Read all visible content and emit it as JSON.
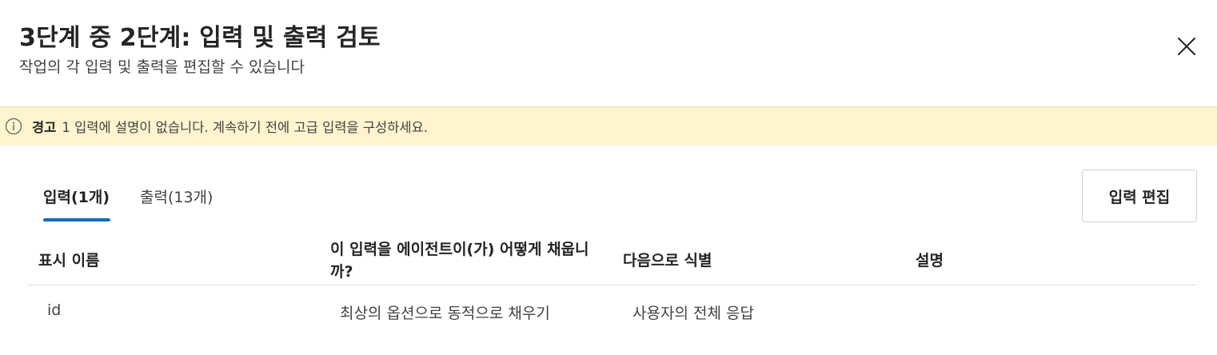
{
  "header": {
    "title": "3단계 중 2단계: 입력 및 출력 검토",
    "subtitle": "작업의 각 입력 및 출력을 편집할 수 있습니다",
    "close_icon": "close-icon"
  },
  "warning": {
    "icon": "info-icon",
    "label": "경고",
    "message": "1 입력에 설명이 없습니다. 계속하기 전에 고급 입력을 구성하세요.",
    "background": "#fff4ce"
  },
  "tabs": [
    {
      "label": "입력(1개)",
      "selected": true
    },
    {
      "label": "출력(13개)",
      "selected": false
    }
  ],
  "edit_button_label": "입력 편집",
  "accent_color": "#0f6cbd",
  "table": {
    "columns": [
      "표시 이름",
      "이 입력을 에이전트이(가) 어떻게 채웁니까?",
      "다음으로 식별",
      "설명"
    ],
    "rows": [
      {
        "display_name": "id",
        "fill_method": "최상의 옵션으로 동적으로 채우기",
        "identify_as": "사용자의 전체 응답",
        "description": ""
      }
    ]
  }
}
